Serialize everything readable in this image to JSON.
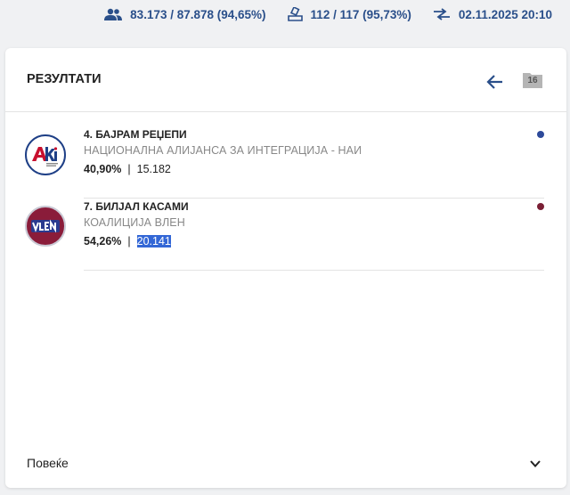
{
  "stats": {
    "voters": "83.173 / 87.878 (94,65%)",
    "stations": "112 / 117 (95,73%)",
    "updated": "02.11.2025 20:10"
  },
  "card": {
    "title": "РЕЗУЛТАТИ",
    "badge": "16",
    "more_label": "Повеќе"
  },
  "candidates": [
    {
      "name": "4. БАЈРАМ РЕЏЕПИ",
      "party": "НАЦИОНАЛНА АЛИЈАНСА ЗА ИНТЕГРАЦИЈА - НАИ",
      "percent": "40,90%",
      "votes": "15.182",
      "dot_color": "#2d4a9a",
      "logo_text": "AKI"
    },
    {
      "name": "7. БИЛЈАЛ КАСАМИ",
      "party": "КОАЛИЦИЈА ВЛЕН",
      "percent": "54,26%",
      "votes": "20.141",
      "dot_color": "#7a1f35",
      "logo_text": "VLEN"
    }
  ],
  "colors": {
    "accent": "#2a4f8a",
    "selection": "#3367d6"
  }
}
